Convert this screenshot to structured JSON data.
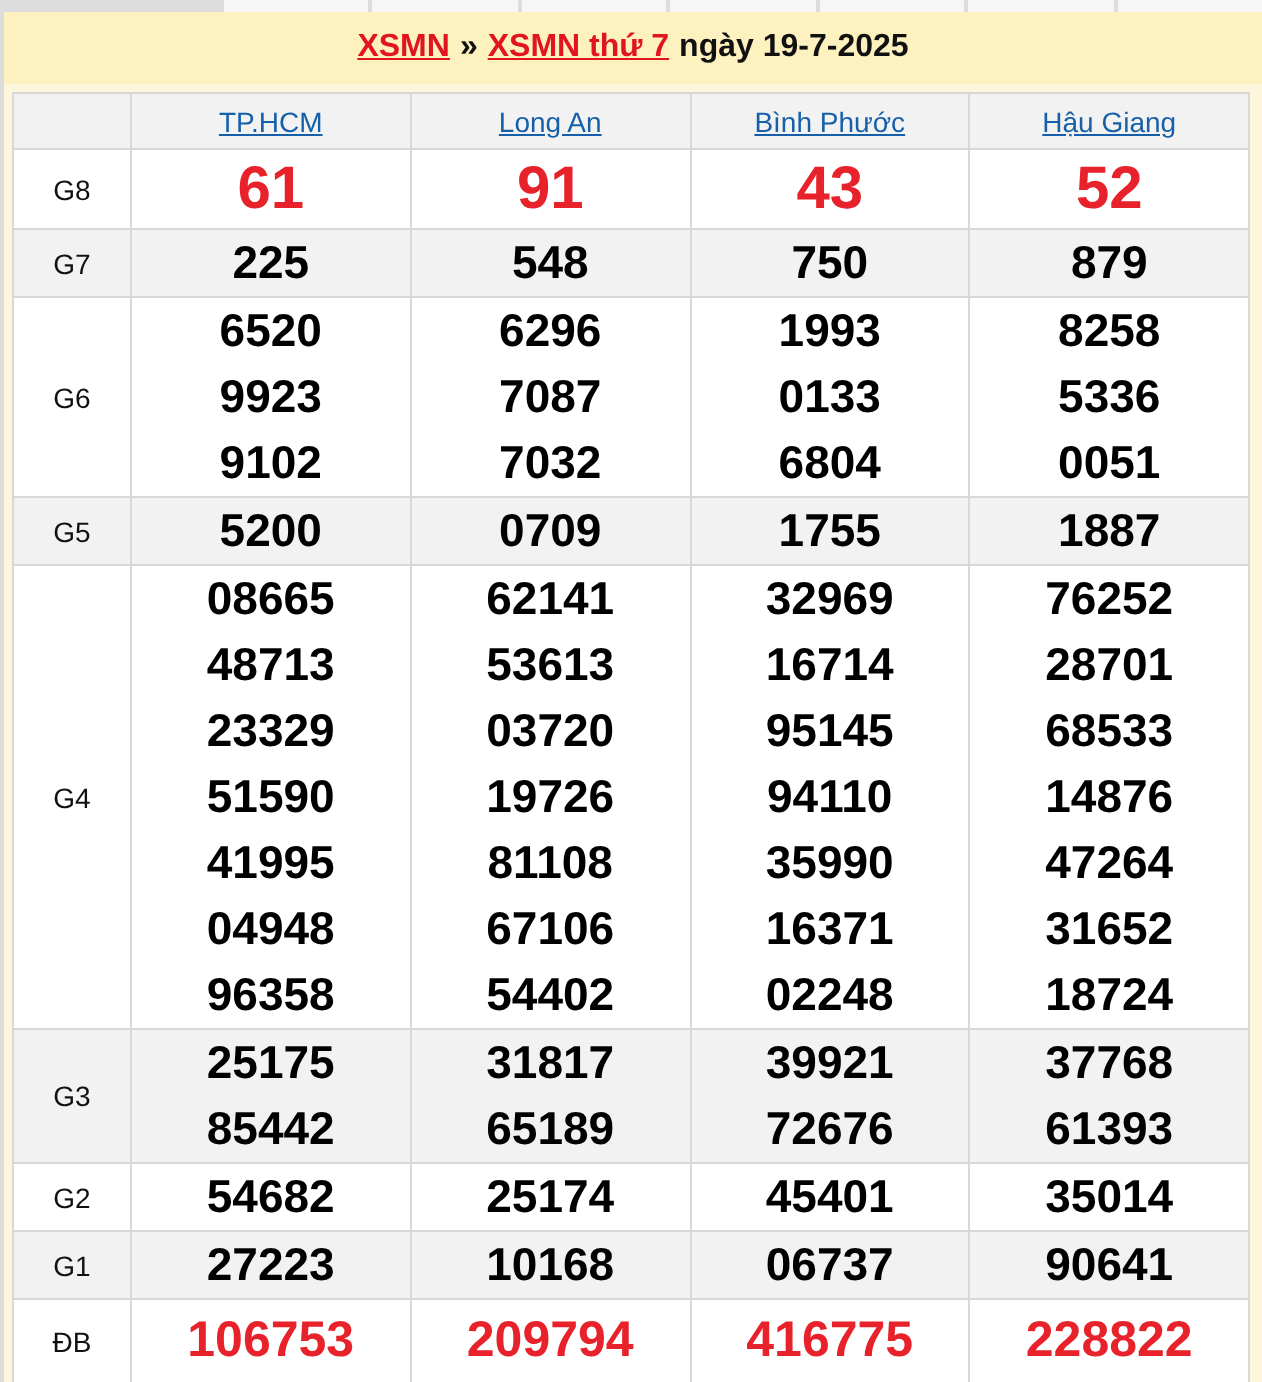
{
  "title": {
    "links": [
      "XSMN",
      "XSMN thứ 7"
    ],
    "separator": "»",
    "text": "ngày 19-7-2025"
  },
  "provinces": [
    "TP.HCM",
    "Long An",
    "Bình Phước",
    "Hậu Giang"
  ],
  "prizes": [
    {
      "label": "G8",
      "kind": "big",
      "numbers": [
        [
          "61"
        ],
        [
          "91"
        ],
        [
          "43"
        ],
        [
          "52"
        ]
      ]
    },
    {
      "label": "G7",
      "kind": "normal",
      "numbers": [
        [
          "225"
        ],
        [
          "548"
        ],
        [
          "750"
        ],
        [
          "879"
        ]
      ]
    },
    {
      "label": "G6",
      "kind": "normal",
      "numbers": [
        [
          "6520",
          "9923",
          "9102"
        ],
        [
          "6296",
          "7087",
          "7032"
        ],
        [
          "1993",
          "0133",
          "6804"
        ],
        [
          "8258",
          "5336",
          "0051"
        ]
      ]
    },
    {
      "label": "G5",
      "kind": "normal",
      "numbers": [
        [
          "5200"
        ],
        [
          "0709"
        ],
        [
          "1755"
        ],
        [
          "1887"
        ]
      ]
    },
    {
      "label": "G4",
      "kind": "normal",
      "numbers": [
        [
          "08665",
          "48713",
          "23329",
          "51590",
          "41995",
          "04948",
          "96358"
        ],
        [
          "62141",
          "53613",
          "03720",
          "19726",
          "81108",
          "67106",
          "54402"
        ],
        [
          "32969",
          "16714",
          "95145",
          "94110",
          "35990",
          "16371",
          "02248"
        ],
        [
          "76252",
          "28701",
          "68533",
          "14876",
          "47264",
          "31652",
          "18724"
        ]
      ]
    },
    {
      "label": "G3",
      "kind": "normal",
      "numbers": [
        [
          "25175",
          "85442"
        ],
        [
          "31817",
          "65189"
        ],
        [
          "39921",
          "72676"
        ],
        [
          "37768",
          "61393"
        ]
      ]
    },
    {
      "label": "G2",
      "kind": "normal",
      "numbers": [
        [
          "54682"
        ],
        [
          "25174"
        ],
        [
          "45401"
        ],
        [
          "35014"
        ]
      ]
    },
    {
      "label": "G1",
      "kind": "normal",
      "numbers": [
        [
          "27223"
        ],
        [
          "10168"
        ],
        [
          "06737"
        ],
        [
          "90641"
        ]
      ]
    },
    {
      "label": "ĐB",
      "kind": "special",
      "numbers": [
        [
          "106753"
        ],
        [
          "209794"
        ],
        [
          "416775"
        ],
        [
          "228822"
        ]
      ]
    }
  ]
}
